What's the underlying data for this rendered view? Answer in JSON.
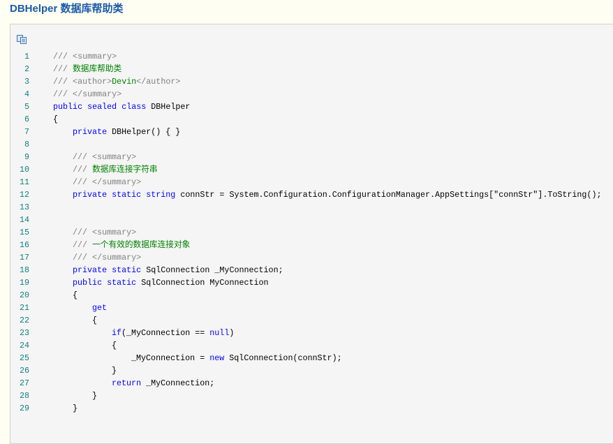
{
  "title": "DBHelper 数据库帮助类",
  "toolbar": {
    "copy_icon": "copy-icon"
  },
  "colors": {
    "keyword": "#0000ff",
    "comment": "#808080",
    "comment_text": "#008000",
    "line_number": "#108080",
    "title": "#1a5aa8"
  },
  "lines": [
    {
      "n": "1",
      "i": 0,
      "t": [
        [
          "c",
          "/// <summary>"
        ]
      ]
    },
    {
      "n": "2",
      "i": 0,
      "t": [
        [
          "c",
          "/// "
        ],
        [
          "g",
          "数据库帮助类"
        ]
      ]
    },
    {
      "n": "3",
      "i": 0,
      "t": [
        [
          "c",
          "/// <author>"
        ],
        [
          "g",
          "Devin"
        ],
        [
          "c",
          "</author>"
        ]
      ]
    },
    {
      "n": "4",
      "i": 0,
      "t": [
        [
          "c",
          "/// </summary>"
        ]
      ]
    },
    {
      "n": "5",
      "i": 0,
      "t": [
        [
          "k",
          "public sealed class "
        ],
        [
          "t",
          "DBHelper"
        ]
      ]
    },
    {
      "n": "6",
      "i": 0,
      "t": [
        [
          "t",
          "{"
        ]
      ]
    },
    {
      "n": "7",
      "i": 1,
      "t": [
        [
          "k",
          "private "
        ],
        [
          "t",
          "DBHelper() { }"
        ]
      ]
    },
    {
      "n": "8",
      "i": 0,
      "t": []
    },
    {
      "n": "9",
      "i": 1,
      "t": [
        [
          "c",
          "/// <summary>"
        ]
      ]
    },
    {
      "n": "10",
      "i": 1,
      "t": [
        [
          "c",
          "/// "
        ],
        [
          "g",
          "数据库连接字符串"
        ]
      ]
    },
    {
      "n": "11",
      "i": 1,
      "t": [
        [
          "c",
          "/// </summary>"
        ]
      ]
    },
    {
      "n": "12",
      "i": 1,
      "t": [
        [
          "k",
          "private static string "
        ],
        [
          "t",
          "connStr = System.Configuration.ConfigurationManager.AppSettings[\"connStr\"].ToString();"
        ]
      ]
    },
    {
      "n": "13",
      "i": 0,
      "t": []
    },
    {
      "n": "14",
      "i": 0,
      "t": []
    },
    {
      "n": "15",
      "i": 1,
      "t": [
        [
          "c",
          "/// <summary>"
        ]
      ]
    },
    {
      "n": "16",
      "i": 1,
      "t": [
        [
          "c",
          "/// "
        ],
        [
          "g",
          "一个有效的数据库连接对象"
        ]
      ]
    },
    {
      "n": "17",
      "i": 1,
      "t": [
        [
          "c",
          "/// </summary>"
        ]
      ]
    },
    {
      "n": "18",
      "i": 1,
      "t": [
        [
          "k",
          "private static "
        ],
        [
          "t",
          "SqlConnection _MyConnection;"
        ]
      ]
    },
    {
      "n": "19",
      "i": 1,
      "t": [
        [
          "k",
          "public static "
        ],
        [
          "t",
          "SqlConnection MyConnection"
        ]
      ]
    },
    {
      "n": "20",
      "i": 1,
      "t": [
        [
          "t",
          "{"
        ]
      ]
    },
    {
      "n": "21",
      "i": 2,
      "t": [
        [
          "k",
          "get"
        ]
      ]
    },
    {
      "n": "22",
      "i": 2,
      "t": [
        [
          "t",
          "{"
        ]
      ]
    },
    {
      "n": "23",
      "i": 3,
      "t": [
        [
          "k",
          "if"
        ],
        [
          "t",
          "(_MyConnection == "
        ],
        [
          "k",
          "null"
        ],
        [
          "t",
          ")"
        ]
      ]
    },
    {
      "n": "24",
      "i": 3,
      "t": [
        [
          "t",
          "{"
        ]
      ]
    },
    {
      "n": "25",
      "i": 4,
      "t": [
        [
          "t",
          "_MyConnection = "
        ],
        [
          "k",
          "new "
        ],
        [
          "t",
          "SqlConnection(connStr);"
        ]
      ]
    },
    {
      "n": "26",
      "i": 3,
      "t": [
        [
          "t",
          "}"
        ]
      ]
    },
    {
      "n": "27",
      "i": 3,
      "t": [
        [
          "k",
          "return "
        ],
        [
          "t",
          "_MyConnection;"
        ]
      ]
    },
    {
      "n": "28",
      "i": 2,
      "t": [
        [
          "t",
          "}"
        ]
      ]
    },
    {
      "n": "29",
      "i": 1,
      "t": [
        [
          "t",
          "}"
        ]
      ]
    }
  ]
}
